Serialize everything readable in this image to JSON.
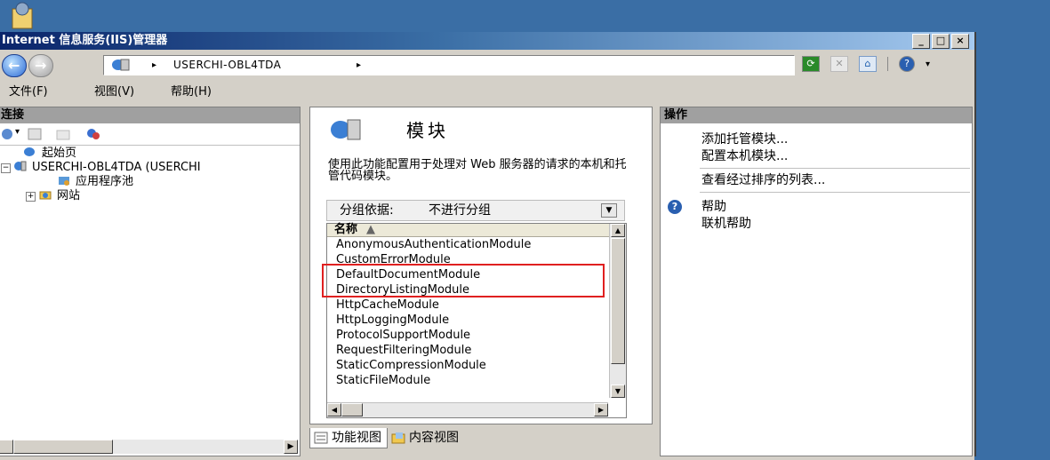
{
  "window": {
    "title": "Internet 信息服务(IIS)管理器",
    "controls": [
      "_",
      "□",
      "×"
    ]
  },
  "address": {
    "path_separator": "▸",
    "server": "USERCHI-OBL4TDA"
  },
  "menu": [
    "文件(F)",
    "视图(V)",
    "帮助(H)"
  ],
  "connections": {
    "header": "连接",
    "tree": [
      {
        "label": "起始页"
      },
      {
        "label": "USERCHI-OBL4TDA (USERCHI"
      },
      {
        "label": "应用程序池"
      },
      {
        "label": "网站"
      }
    ]
  },
  "modules": {
    "title": "模块",
    "description": "使用此功能配置用于处理对 Web 服务器的请求的本机和托管代码模块。",
    "group_label": "分组依据:",
    "group_value": "不进行分组",
    "column_name": "名称",
    "sort_indicator": "▲",
    "items": [
      "AnonymousAuthenticationModule",
      "CustomErrorModule",
      "DefaultDocumentModule",
      "DirectoryListingModule",
      "HttpCacheModule",
      "HttpLoggingModule",
      "ProtocolSupportModule",
      "RequestFilteringModule",
      "StaticCompressionModule",
      "StaticFileModule"
    ],
    "tabs": [
      "功能视图",
      "内容视图"
    ]
  },
  "actions": {
    "header": "操作",
    "links": [
      "添加托管模块...",
      "配置本机模块...",
      "查看经过排序的列表..."
    ],
    "help": [
      "帮助",
      "联机帮助"
    ]
  },
  "colors": {
    "desktop": "#3a6ea5",
    "titlebar_start": "#0a246a",
    "highlight_box": "#e02020"
  }
}
